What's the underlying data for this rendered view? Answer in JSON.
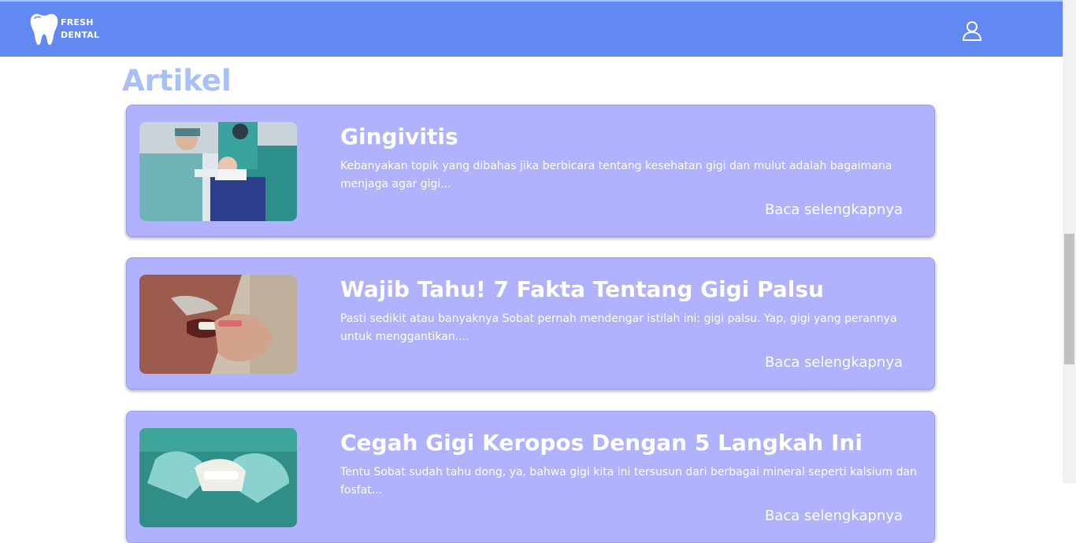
{
  "header": {
    "brand_line1": "FRESH",
    "brand_line2": "DENTAL",
    "logo_icon": "tooth-icon",
    "user_icon": "user-icon"
  },
  "colors": {
    "navbar": "#6189f1",
    "section_title": "#a9c0f6",
    "card_bg": "#b0b2fe",
    "text_on_card": "#ffffff"
  },
  "section": {
    "title": "Artikel"
  },
  "articles": [
    {
      "title": "Gingivitis",
      "excerpt": "Kebanyakan topik yang dibahas jika berbicara tentang kesehatan gigi dan mulut adalah bagaimana menjaga agar gigi...",
      "link": "Baca selengkapnya",
      "image": "dentist-treating-patient-photo"
    },
    {
      "title": "Wajib Tahu! 7 Fakta Tentang Gigi Palsu",
      "excerpt": "Pasti sedikit atau banyaknya Sobat pernah mendengar istilah ini: gigi palsu. Yap, gigi yang perannya untuk menggantikan....",
      "link": "Baca selengkapnya",
      "image": "man-inserting-denture-photo"
    },
    {
      "title": "Cegah Gigi Keropos Dengan 5 Langkah Ini",
      "excerpt": "Tentu Sobat sudah tahu dong, ya, bahwa gigi kita ini tersusun dari berbagai mineral seperti kalsium dan fosfat...",
      "link": "Baca selengkapnya",
      "image": "gloved-hands-holding-teeth-model-photo"
    }
  ]
}
